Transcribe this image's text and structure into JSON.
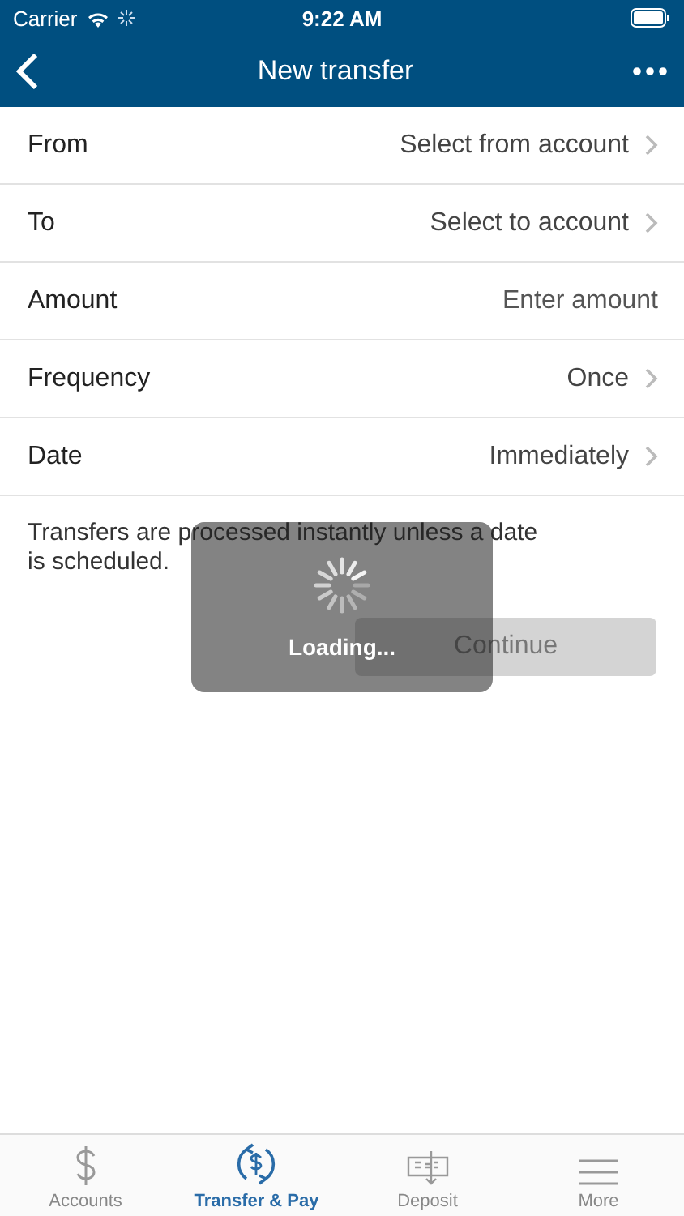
{
  "status_bar": {
    "carrier": "Carrier",
    "time": "9:22 AM"
  },
  "nav": {
    "title": "New transfer"
  },
  "rows": [
    {
      "label": "From",
      "kind": "select",
      "value": "Select from account"
    },
    {
      "label": "To",
      "kind": "select",
      "value": "Select to account"
    },
    {
      "label": "Amount",
      "kind": "input",
      "placeholder": "Enter amount"
    },
    {
      "label": "Frequency",
      "kind": "select",
      "value": "Once"
    },
    {
      "label": "Date",
      "kind": "select",
      "value": "Immediately"
    }
  ],
  "note": "Transfers are processed instantly unless a date is scheduled.",
  "continue_button": {
    "label": "Continue",
    "disabled": true
  },
  "loading": {
    "label": "Loading..."
  },
  "tabs": [
    {
      "label": "Accounts",
      "kind": "dollar",
      "selected": false
    },
    {
      "label": "Transfer & Pay",
      "kind": "transfer",
      "selected": true
    },
    {
      "label": "Deposit",
      "kind": "deposit",
      "selected": false
    },
    {
      "label": "More",
      "kind": "more",
      "selected": false
    }
  ]
}
